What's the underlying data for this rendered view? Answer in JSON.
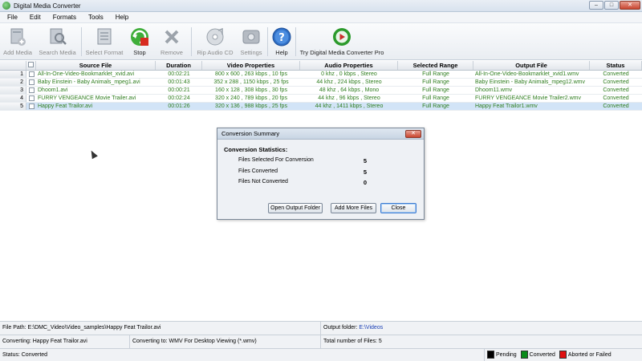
{
  "window": {
    "title": "Digital Media Converter"
  },
  "menu": [
    "File",
    "Edit",
    "Formats",
    "Tools",
    "Help"
  ],
  "toolbar": {
    "add_media": "Add Media",
    "search_media": "Search Media",
    "select_format": "Select Format",
    "stop": "Stop",
    "remove": "Remove",
    "rip_audio_cd": "Rip Audio CD",
    "settings": "Settings",
    "help": "Help",
    "try_pro": "Try Digital Media Converter Pro"
  },
  "grid": {
    "headers": [
      "Source File",
      "Duration",
      "Video Properties",
      "Audio Properties",
      "Selected Range",
      "Output File",
      "Status"
    ],
    "rows": [
      {
        "num": "1",
        "source": "All-In-One-Video-Bookmarklet_xvid.avi",
        "duration": "00:02:21",
        "video": "800 x 600 , 263 kbps , 10 fps",
        "audio": "0 khz , 0 kbps , Stereo",
        "range": "Full Range",
        "output": "All-In-One-Video-Bookmarklet_xvid1.wmv",
        "status": "Converted"
      },
      {
        "num": "2",
        "source": "Baby Einstein - Baby Animals_mpeg1.avi",
        "duration": "00:01:43",
        "video": "352 x 288 , 1150 kbps , 25 fps",
        "audio": "44 khz , 224 kbps , Stereo",
        "range": "Full Range",
        "output": "Baby Einstein - Baby Animals_mpeg12.wmv",
        "status": "Converted"
      },
      {
        "num": "3",
        "source": "Dhoom1.avi",
        "duration": "00:00:21",
        "video": "160 x 128 , 308 kbps , 30 fps",
        "audio": "48 khz , 64 kbps , Mono",
        "range": "Full Range",
        "output": "Dhoom11.wmv",
        "status": "Converted"
      },
      {
        "num": "4",
        "source": "FURRY VENGEANCE Movie Trailer.avi",
        "duration": "00:02:24",
        "video": "320 x 240 , 789 kbps , 20 fps",
        "audio": "44 khz , 96 kbps , Stereo",
        "range": "Full Range",
        "output": "FURRY VENGEANCE Movie Trailer2.wmv",
        "status": "Converted"
      },
      {
        "num": "5",
        "source": "Happy Feat Trailor.avi",
        "duration": "00:01:26",
        "video": "320 x 136 , 988 kbps , 25 fps",
        "audio": "44 khz , 1411 kbps , Stereo",
        "range": "Full Range",
        "output": "Happy Feat Trailor1.wmv",
        "status": "Converted"
      }
    ]
  },
  "dialog": {
    "title": "Conversion Summary",
    "close_glyph": "✕",
    "heading": "Conversion Statistics:",
    "stats": [
      {
        "label": "Files Selected For Conversion",
        "value": "5"
      },
      {
        "label": "Files Converted",
        "value": "5"
      },
      {
        "label": "Files Not Converted",
        "value": "0"
      }
    ],
    "open_output_folder": "Open Output Folder",
    "add_more_files": "Add More Files",
    "close": "Close"
  },
  "statusbar": {
    "file_path_label": "File Path:",
    "file_path": "E:\\DMC_Video\\Video_samples\\Happy Feat Trailor.avi",
    "output_folder_label": "Output folder:",
    "output_folder": "E:\\Videos",
    "converting_label": "Converting:",
    "converting": "Happy Feat Trailor.avi",
    "converting_to_label": "Converting to:",
    "converting_to": "WMV For Desktop Viewing (*.wmv)",
    "total_files_label": "Total number of Files:",
    "total_files": "5",
    "status_label": "Status:",
    "status": "Converted",
    "legend_pending": "Pending",
    "legend_converted": "Converted",
    "legend_failed": "Aborted or Failed"
  },
  "colors": {
    "row_text": "#2e7d1e",
    "selected_row": "#d2e4f7",
    "legend_pending": "#000000",
    "legend_converted": "#0a8a1a",
    "legend_failed": "#e01010"
  }
}
